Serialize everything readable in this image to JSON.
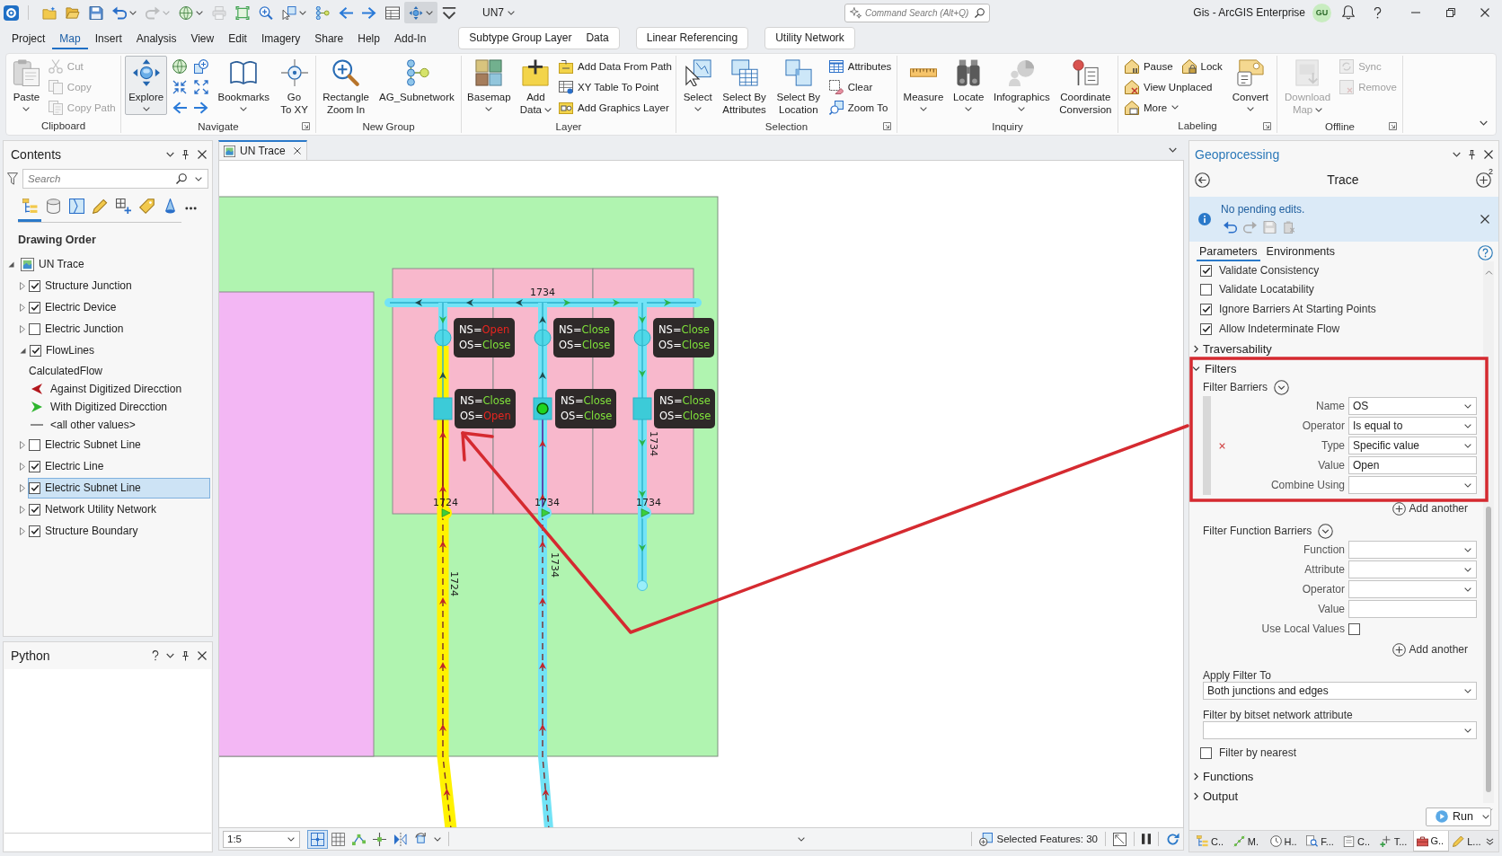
{
  "title_bar": {
    "quick_access": [
      {
        "dropdown": false,
        "disabled": false,
        "pressed": false
      },
      {
        "dropdown": false,
        "disabled": false,
        "pressed": false
      },
      {
        "dropdown": false,
        "disabled": false,
        "pressed": false
      },
      {
        "dropdown": true,
        "disabled": false,
        "pressed": false
      },
      {
        "dropdown": true,
        "disabled": true,
        "pressed": false
      },
      {
        "dropdown": true,
        "disabled": false,
        "pressed": false
      },
      {
        "dropdown": false,
        "disabled": true,
        "pressed": false
      },
      {
        "dropdown": false,
        "disabled": false,
        "pressed": false
      },
      {
        "dropdown": false,
        "disabled": false,
        "pressed": false
      },
      {
        "dropdown": true,
        "disabled": false,
        "pressed": false
      },
      {
        "dropdown": false,
        "disabled": false,
        "pressed": false
      },
      {
        "dropdown": false,
        "disabled": false,
        "pressed": false
      },
      {
        "dropdown": false,
        "disabled": false,
        "pressed": false
      },
      {
        "dropdown": false,
        "disabled": false,
        "pressed": false
      },
      {
        "dropdown": true,
        "disabled": false,
        "pressed": true
      },
      {
        "dropdown": false,
        "disabled": false,
        "pressed": false
      }
    ],
    "project": "UN7",
    "command_search": {
      "placeholder": "Command Search (Alt+Q)"
    },
    "app_title": "Gis - ArcGIS Enterprise",
    "user_initials": "GU"
  },
  "menu_tabs": [
    {
      "label": "Project",
      "selected": false
    },
    {
      "label": "Map",
      "selected": true
    },
    {
      "label": "Insert",
      "selected": false
    },
    {
      "label": "Analysis",
      "selected": false
    },
    {
      "label": "View",
      "selected": false
    },
    {
      "label": "Edit",
      "selected": false
    },
    {
      "label": "Imagery",
      "selected": false
    },
    {
      "label": "Share",
      "selected": false
    },
    {
      "label": "Help",
      "selected": false
    },
    {
      "label": "Add-In",
      "selected": false
    }
  ],
  "contextual_groups": [
    {
      "tabs": [
        {
          "label": "Subtype Group Layer",
          "selected": false
        },
        {
          "label": "Data",
          "selected": false
        }
      ]
    },
    {
      "tabs": [
        {
          "label": "Linear Referencing",
          "selected": false
        }
      ]
    },
    {
      "tabs": [
        {
          "label": "Utility Network",
          "selected": false
        }
      ]
    }
  ],
  "ribbon": {
    "groups": [
      {
        "title": "Clipboard",
        "launcher": false,
        "items": [
          {
            "kind": "large",
            "label": "Paste",
            "dropdown": true,
            "disabled": false,
            "pressed": false
          },
          {
            "kind": "small",
            "label": "Cut",
            "dropdown": false,
            "disabled": true
          },
          {
            "kind": "small",
            "label": "Copy",
            "dropdown": false,
            "disabled": true
          },
          {
            "kind": "small",
            "label": "Copy Path",
            "dropdown": false,
            "disabled": true
          }
        ]
      },
      {
        "title": "Navigate",
        "launcher": true,
        "items": [
          {
            "kind": "large",
            "label": "Explore",
            "dropdown": true,
            "disabled": false,
            "pressed": true
          },
          {
            "kind": "tool",
            "disabled": false
          },
          {
            "kind": "tool",
            "disabled": false
          },
          {
            "kind": "tool",
            "disabled": false
          },
          {
            "kind": "tool",
            "disabled": false
          },
          {
            "kind": "tool",
            "disabled": false
          },
          {
            "kind": "tool",
            "disabled": false
          },
          {
            "kind": "large",
            "label": "Bookmarks",
            "dropdown": true,
            "disabled": false,
            "pressed": false
          },
          {
            "kind": "large",
            "label": "Go\nTo XY",
            "dropdown": false,
            "disabled": false,
            "pressed": false
          }
        ]
      },
      {
        "title": "New Group",
        "launcher": false,
        "items": [
          {
            "kind": "large",
            "label": "Rectangle\nZoom In",
            "dropdown": false,
            "disabled": false,
            "pressed": false
          },
          {
            "kind": "large",
            "label": "AG_Subnetwork",
            "dropdown": false,
            "disabled": false,
            "pressed": false
          }
        ]
      },
      {
        "title": "Layer",
        "launcher": false,
        "items": [
          {
            "kind": "large",
            "label": "Basemap",
            "dropdown": true,
            "disabled": false,
            "pressed": false
          },
          {
            "kind": "large",
            "label": "Add\nData",
            "dropdown": true,
            "disabled": false,
            "pressed": false
          },
          {
            "kind": "small",
            "label": "Add Data From Path",
            "dropdown": false,
            "disabled": false
          },
          {
            "kind": "small",
            "label": "XY Table To Point",
            "dropdown": false,
            "disabled": false
          },
          {
            "kind": "small",
            "label": "Add Graphics Layer",
            "dropdown": false,
            "disabled": false
          }
        ]
      },
      {
        "title": "Selection",
        "launcher": true,
        "items": [
          {
            "kind": "large",
            "label": "Select",
            "dropdown": true,
            "disabled": false,
            "pressed": false
          },
          {
            "kind": "large",
            "label": "Select By\nAttributes",
            "dropdown": false,
            "disabled": false,
            "pressed": false
          },
          {
            "kind": "large",
            "label": "Select By\nLocation",
            "dropdown": false,
            "disabled": false,
            "pressed": false
          },
          {
            "kind": "small",
            "label": "Attributes",
            "dropdown": false,
            "disabled": false
          },
          {
            "kind": "small",
            "label": "Clear",
            "dropdown": false,
            "disabled": false
          },
          {
            "kind": "small",
            "label": "Zoom To",
            "dropdown": false,
            "disabled": false
          }
        ]
      },
      {
        "title": "Inquiry",
        "launcher": false,
        "items": [
          {
            "kind": "large",
            "label": "Measure",
            "dropdown": true,
            "disabled": false,
            "pressed": false
          },
          {
            "kind": "large",
            "label": "Locate",
            "dropdown": true,
            "disabled": false,
            "pressed": false
          },
          {
            "kind": "large",
            "label": "Infographics",
            "dropdown": true,
            "disabled": false,
            "pressed": false
          },
          {
            "kind": "large",
            "label": "Coordinate\nConversion",
            "dropdown": false,
            "disabled": false,
            "pressed": false
          }
        ]
      },
      {
        "title": "Labeling",
        "launcher": true,
        "items": [
          {
            "kind": "small",
            "label": "Pause",
            "dropdown": false,
            "disabled": false
          },
          {
            "kind": "small",
            "label": "Lock",
            "dropdown": false,
            "disabled": false
          },
          {
            "kind": "small",
            "label": "View Unplaced",
            "dropdown": false,
            "disabled": false
          },
          {
            "kind": "small",
            "label": "More",
            "dropdown": true,
            "disabled": false
          },
          {
            "kind": "large",
            "label": "Convert",
            "dropdown": true,
            "disabled": false,
            "pressed": false
          }
        ]
      },
      {
        "title": "Offline",
        "launcher": true,
        "items": [
          {
            "kind": "large",
            "label": "Download\nMap",
            "dropdown": true,
            "disabled": true,
            "pressed": false
          },
          {
            "kind": "small",
            "label": "Sync",
            "dropdown": false,
            "disabled": true
          },
          {
            "kind": "small",
            "label": "Remove",
            "dropdown": false,
            "disabled": true
          }
        ]
      }
    ]
  },
  "contents": {
    "title": "Contents",
    "search": {
      "placeholder": "Search"
    },
    "views": [
      {
        "selected": true
      },
      {
        "selected": false
      },
      {
        "selected": false
      },
      {
        "selected": false
      },
      {
        "selected": false
      },
      {
        "selected": false
      },
      {
        "selected": false
      }
    ],
    "heading": "Drawing Order",
    "layers": [
      {
        "kind": "map",
        "label": "UN Trace",
        "expanded": true,
        "selected": false,
        "children": [
          {
            "kind": "layer",
            "label": "Structure Junction",
            "checked": true,
            "expanded": false,
            "selected": false
          },
          {
            "kind": "layer",
            "label": "Electric Device",
            "checked": true,
            "expanded": false,
            "selected": false
          },
          {
            "kind": "layer",
            "label": "Electric Junction",
            "checked": false,
            "expanded": false,
            "selected": false
          },
          {
            "kind": "layer",
            "label": "FlowLines",
            "checked": true,
            "expanded": true,
            "selected": false,
            "legend": {
              "field": "CalculatedFlow",
              "classes": [
                {
                  "kind": "left",
                  "label": "Against Digitized Direcction",
                  "color": "#b3171d"
                },
                {
                  "kind": "right",
                  "label": "With Digitized Direcction",
                  "color": "#2fb52f"
                },
                {
                  "kind": "line",
                  "label": "<all other values>",
                  "color": "#8c8c8c"
                }
              ]
            }
          },
          {
            "kind": "layer",
            "label": "Electric Subnet Line",
            "checked": false,
            "expanded": false,
            "selected": false
          },
          {
            "kind": "layer",
            "label": "Electric Line",
            "checked": true,
            "expanded": false,
            "selected": false
          },
          {
            "kind": "layer",
            "label": "Electric Subnet Line",
            "checked": true,
            "expanded": false,
            "selected": true
          },
          {
            "kind": "layer",
            "label": "Network Utility Network",
            "checked": true,
            "expanded": false,
            "selected": false
          },
          {
            "kind": "layer",
            "label": "Structure Boundary",
            "checked": true,
            "expanded": false,
            "selected": false
          }
        ]
      }
    ]
  },
  "python": {
    "title": "Python"
  },
  "map_view": {
    "tabs": [
      {
        "label": "UN Trace",
        "selected": true
      }
    ],
    "line_labels": [
      "1734",
      "1724",
      "1734",
      "1734",
      "1724",
      "1734",
      "1734"
    ],
    "callouts": [
      {
        "lines": [
          {
            "field": "NS=",
            "value": "Open",
            "color": "#e8251f"
          },
          {
            "field": "OS=",
            "value": "Close",
            "color": "#7ee03a"
          }
        ]
      },
      {
        "lines": [
          {
            "field": "NS=",
            "value": "Close",
            "color": "#7ee03a"
          },
          {
            "field": "OS=",
            "value": "Close",
            "color": "#7ee03a"
          }
        ]
      },
      {
        "lines": [
          {
            "field": "NS=",
            "value": "Close",
            "color": "#7ee03a"
          },
          {
            "field": "OS=",
            "value": "Close",
            "color": "#7ee03a"
          }
        ]
      },
      {
        "lines": [
          {
            "field": "NS=",
            "value": "Close",
            "color": "#7ee03a"
          },
          {
            "field": "OS=",
            "value": "Open",
            "color": "#e8251f"
          }
        ]
      },
      {
        "lines": [
          {
            "field": "NS=",
            "value": "Close",
            "color": "#7ee03a"
          },
          {
            "field": "OS=",
            "value": "Close",
            "color": "#7ee03a"
          }
        ]
      },
      {
        "lines": [
          {
            "field": "NS=",
            "value": "Close",
            "color": "#7ee03a"
          },
          {
            "field": "OS=",
            "value": "Close",
            "color": "#7ee03a"
          }
        ]
      }
    ],
    "status_bar": {
      "scale": "1:5",
      "tools": [
        {
          "pressed": true
        },
        {
          "pressed": false
        },
        {
          "pressed": false
        },
        {
          "pressed": false
        },
        {
          "pressed": false
        },
        {
          "pressed": false
        }
      ],
      "selected_features": "Selected Features: 30"
    }
  },
  "geoprocessing": {
    "title": "Geoprocessing",
    "tool": "Trace",
    "add_badge": "2",
    "banner": {
      "message": "No pending edits."
    },
    "tabs": [
      {
        "label": "Parameters",
        "selected": true
      },
      {
        "label": "Environments",
        "selected": false
      }
    ],
    "parameters": [
      {
        "kind": "checkbox",
        "label": "Validate Consistency",
        "checked": true
      },
      {
        "kind": "checkbox",
        "label": "Validate Locatability",
        "checked": false
      },
      {
        "kind": "checkbox",
        "label": "Ignore Barriers At Starting Points",
        "checked": true
      },
      {
        "kind": "checkbox",
        "label": "Allow Indeterminate Flow",
        "checked": true
      },
      {
        "kind": "section",
        "label": "Traversability",
        "expanded": false
      },
      {
        "kind": "section",
        "label": "Filters",
        "expanded": true,
        "children": [
          {
            "kind": "group",
            "label": "Filter Barriers",
            "expanded": true,
            "removable": true,
            "fields": [
              {
                "kind": "dropdown",
                "label": "Name",
                "value": "OS"
              },
              {
                "kind": "dropdown",
                "label": "Operator",
                "value": "Is equal to"
              },
              {
                "kind": "dropdown",
                "label": "Type",
                "value": "Specific value"
              },
              {
                "kind": "text",
                "label": "Value",
                "value": "Open"
              },
              {
                "kind": "dropdown",
                "label": "Combine Using"
              }
            ],
            "add_label": "Add another"
          },
          {
            "kind": "group",
            "label": "Filter Function Barriers",
            "expanded": true,
            "removable": false,
            "fields": [
              {
                "kind": "dropdown",
                "label": "Function"
              },
              {
                "kind": "dropdown",
                "label": "Attribute"
              },
              {
                "kind": "dropdown",
                "label": "Operator"
              },
              {
                "kind": "text",
                "label": "Value"
              },
              {
                "kind": "checkbox",
                "label": "Use Local Values",
                "checked": false
              }
            ],
            "add_label": "Add another"
          },
          {
            "kind": "select",
            "label": "Apply Filter To",
            "value": "Both junctions and edges"
          },
          {
            "kind": "select",
            "label": "Filter by bitset network attribute"
          },
          {
            "kind": "checkbox",
            "label": "Filter by nearest",
            "checked": false
          }
        ]
      },
      {
        "kind": "section",
        "label": "Functions",
        "expanded": false
      },
      {
        "kind": "section",
        "label": "Output",
        "expanded": false
      }
    ],
    "run": "Run",
    "pane_tabs": [
      {
        "label": "C..",
        "selected": false
      },
      {
        "label": "M.",
        "selected": false
      },
      {
        "label": "H..",
        "selected": false
      },
      {
        "label": "F...",
        "selected": false
      },
      {
        "label": "C..",
        "selected": false
      },
      {
        "label": "T...",
        "selected": false
      },
      {
        "label": "G..",
        "selected": true
      },
      {
        "label": "L...",
        "selected": false
      }
    ]
  }
}
